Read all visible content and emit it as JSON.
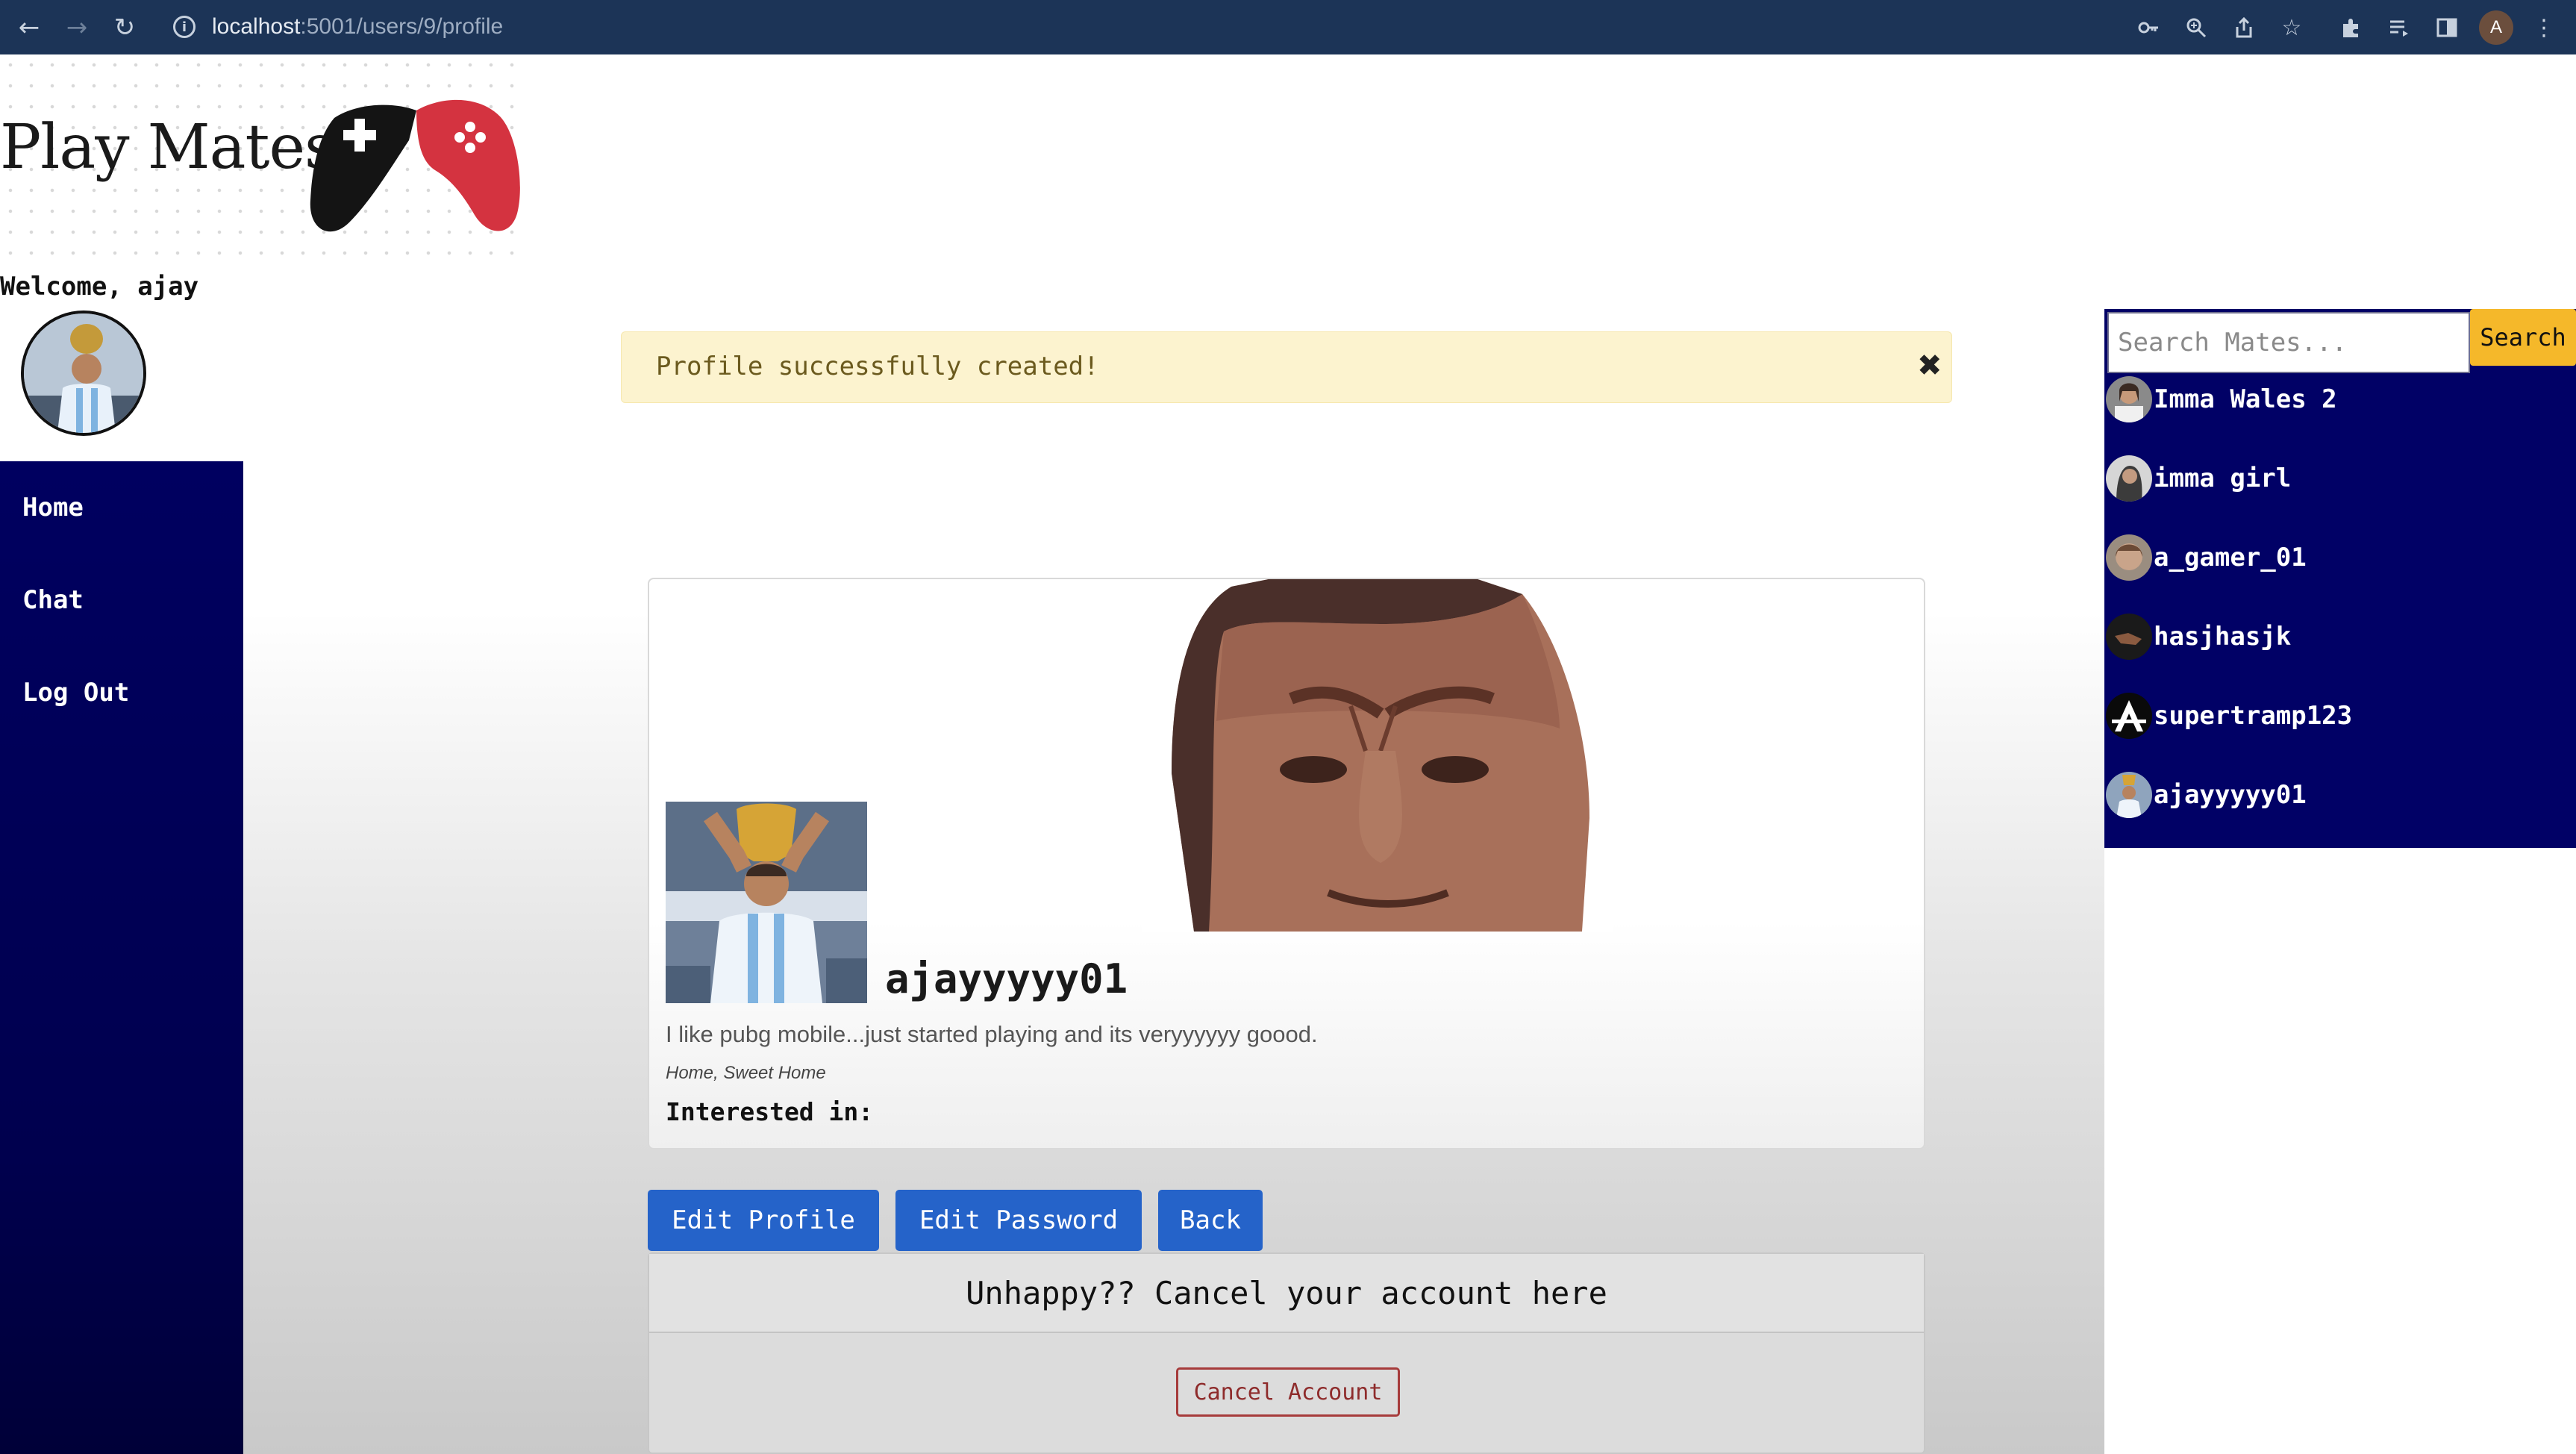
{
  "browser": {
    "url_host": "localhost",
    "url_path": ":5001/users/9/profile"
  },
  "logo": {
    "text": "Play Mates"
  },
  "welcome": {
    "text": "Welcome, ajay"
  },
  "sidebar": {
    "items": [
      {
        "label": "Home"
      },
      {
        "label": "Chat"
      },
      {
        "label": "Log Out"
      }
    ]
  },
  "alert": {
    "message": "Profile successfully created!",
    "close_glyph": "✖"
  },
  "search": {
    "placeholder": "Search Mates...",
    "button_label": "Search",
    "results": [
      {
        "name": "Imma Wales 2"
      },
      {
        "name": "imma girl"
      },
      {
        "name": "a_gamer_01"
      },
      {
        "name": "hasjhasjk"
      },
      {
        "name": "supertramp123"
      },
      {
        "name": "ajayyyyy01"
      }
    ]
  },
  "profile": {
    "username": "ajayyyyy01",
    "bio": "I like pubg mobile...just started playing and its veryyyyyy goood.",
    "location": "Home, Sweet Home",
    "interested_label": "Interested in:"
  },
  "actions": {
    "edit_profile": "Edit Profile",
    "edit_password": "Edit Password",
    "back": "Back"
  },
  "cancel": {
    "header": "Unhappy?? Cancel your account here",
    "button_label": "Cancel Account"
  },
  "colors": {
    "navy": "#000060",
    "search_panel": "#010166",
    "search_button": "#f5b82a",
    "primary_button": "#2563c9",
    "alert_bg": "#fcf3cf",
    "danger": "#a63b3b"
  }
}
